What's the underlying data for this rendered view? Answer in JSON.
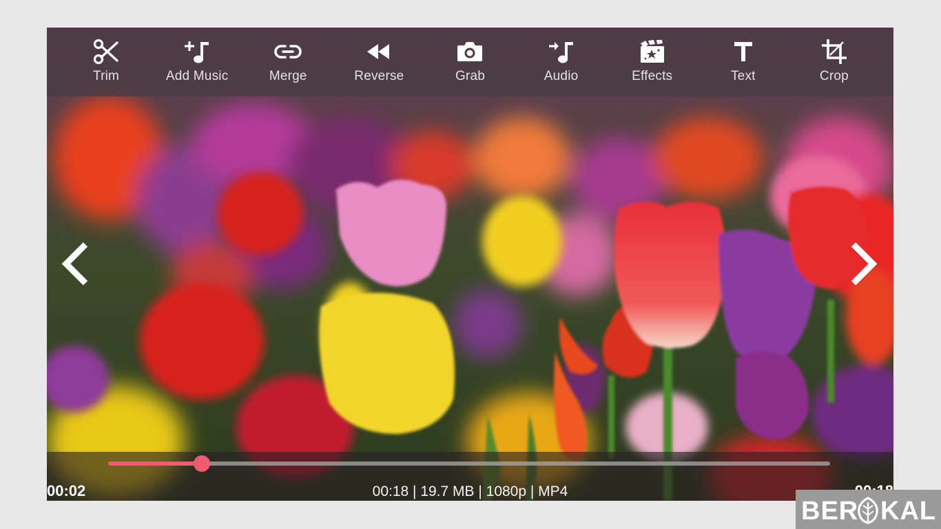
{
  "toolbar": {
    "tools": [
      {
        "label": "Trim",
        "icon": "scissors-icon"
      },
      {
        "label": "Add Music",
        "icon": "add-music-icon"
      },
      {
        "label": "Merge",
        "icon": "link-icon"
      },
      {
        "label": "Reverse",
        "icon": "rewind-icon"
      },
      {
        "label": "Grab",
        "icon": "camera-icon"
      },
      {
        "label": "Audio",
        "icon": "audio-icon"
      },
      {
        "label": "Effects",
        "icon": "effects-icon"
      },
      {
        "label": "Text",
        "icon": "text-icon"
      },
      {
        "label": "Crop",
        "icon": "crop-icon"
      }
    ]
  },
  "navigation": {
    "previous_icon": "chevron-left-icon",
    "next_icon": "chevron-right-icon"
  },
  "player": {
    "current_time": "00:02",
    "duration": "00:18",
    "info": "00:18 | 19.7 MB | 1080p | MP4",
    "progress_fraction": 0.13,
    "accent_color": "#ef5b6f"
  },
  "watermark": {
    "text": "BERAKAL",
    "icon": "leaf-icon"
  }
}
